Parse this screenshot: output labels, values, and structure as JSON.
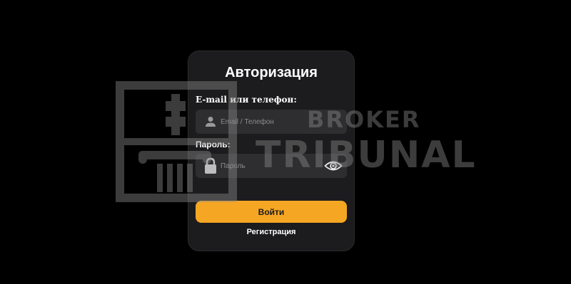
{
  "auth": {
    "title": "Авторизация",
    "email_label": "E-mail или телефон:",
    "email_placeholder": "Email / Телефон",
    "password_label": "Пароль:",
    "password_placeholder": "Пароль",
    "login_button": "Войти",
    "register_link": "Регистрация"
  },
  "watermark": {
    "line1": "BROKER",
    "line2": "TRIBUNAL"
  },
  "icons": {
    "email": "user-icon",
    "password": "lock-icon",
    "toggle": "eye-icon"
  },
  "colors": {
    "background": "#000000",
    "card": "#1c1c1e",
    "input": "#2e2e31",
    "accent": "#f5a623",
    "text": "#ffffff"
  }
}
